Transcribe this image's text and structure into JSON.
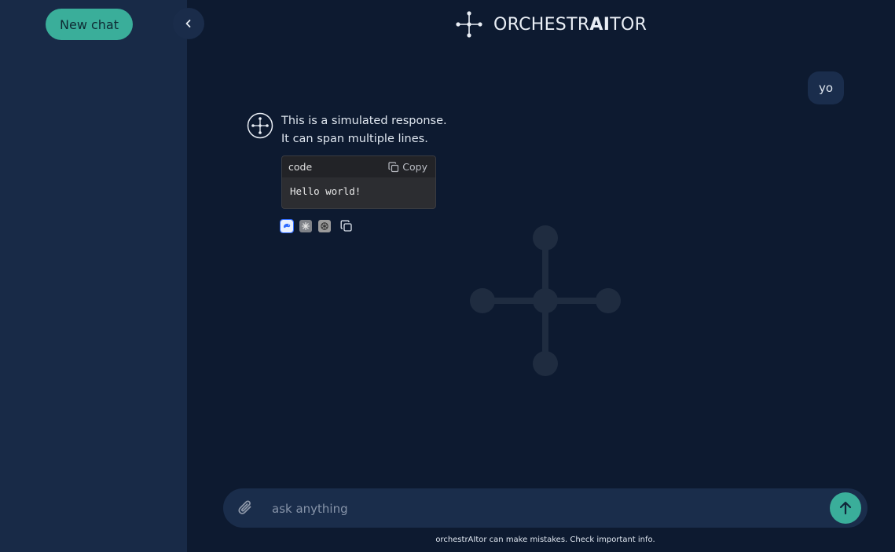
{
  "sidebar": {
    "new_chat_label": "New chat"
  },
  "header": {
    "brand_prefix": "ORCHESTR",
    "brand_bold": "AI",
    "brand_suffix": "TOR"
  },
  "conversation": {
    "user_message": "yo",
    "bot_line1": "This is a simulated response.",
    "bot_line2": "It can span multiple lines.",
    "code_block": {
      "language": "code",
      "copy_label": "Copy",
      "content": "Hello world!"
    },
    "actions": [
      "model-a-icon",
      "model-b-icon",
      "model-c-icon",
      "copy-icon"
    ]
  },
  "composer": {
    "placeholder": "ask anything",
    "disclaimer": "orchestrAItor can make mistakes. Check important info."
  },
  "colors": {
    "accent": "#3aae9a",
    "background": "#0d1a30",
    "sidebar": "#182a47"
  }
}
